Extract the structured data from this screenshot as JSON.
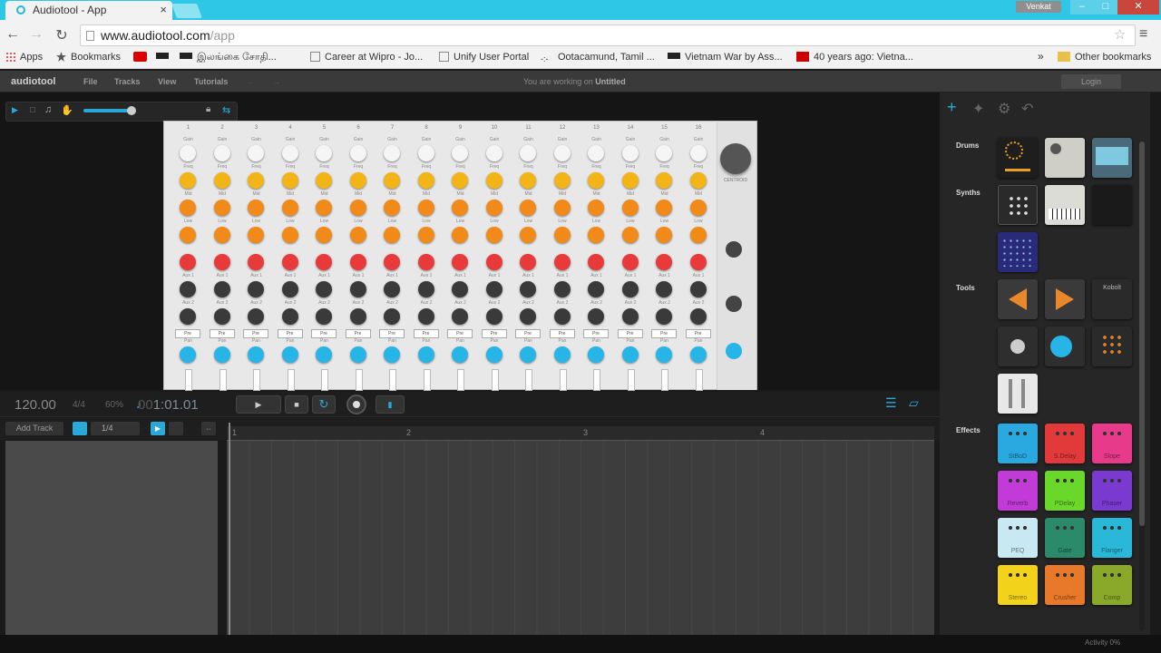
{
  "browser": {
    "tab_title": "Audiotool - App",
    "user_button": "Venkat",
    "url_host": "www.audiotool.com",
    "url_path": "/app",
    "bookmarks": [
      {
        "label": "Apps"
      },
      {
        "label": "Bookmarks"
      },
      {
        "label": ""
      },
      {
        "label": ""
      },
      {
        "label": "இலங்கை சோதி..."
      },
      {
        "label": "Career at Wipro - Jo..."
      },
      {
        "label": "Unify User Portal"
      },
      {
        "label": "Ootacamund, Tamil ..."
      },
      {
        "label": "Vietnam War by Ass..."
      },
      {
        "label": "40 years ago: Vietna..."
      }
    ],
    "more_bookmarks": "»",
    "other_bookmarks": "Other bookmarks"
  },
  "app": {
    "logo": "audiotool",
    "menu": [
      "File",
      "Tracks",
      "View",
      "Tutorials"
    ],
    "working_prefix": "You are working on",
    "working_doc": "Untitled",
    "login": "Login"
  },
  "mixer": {
    "channels": [
      "1",
      "2",
      "3",
      "4",
      "5",
      "6",
      "7",
      "8",
      "9",
      "10",
      "11",
      "12",
      "13",
      "14",
      "15",
      "16"
    ],
    "knob_labels": [
      "Gain",
      "Freq",
      "Mid",
      "Low",
      "Aux 1",
      "Aux 2",
      "Pan"
    ],
    "pre_label": "Pre",
    "master_label": "CENTROID",
    "colors": {
      "yellow": "#f2b416",
      "orange": "#f28a1a",
      "red": "#e83a3a",
      "dark": "#3a3a3a",
      "cyan": "#27b4e6",
      "white": "#f5f5f5"
    }
  },
  "transport": {
    "bpm": "120.00",
    "signature": "4/4",
    "shuffle": "60%",
    "time_dim": "00",
    "time": "1:01.01",
    "play": "▶",
    "stop": "■"
  },
  "tracks": {
    "add_track": "Add Track",
    "quantize": "1/4",
    "ruler_marks": [
      "1",
      "2",
      "3",
      "4"
    ]
  },
  "panel": {
    "sections": [
      "Drums",
      "Synths",
      "Tools",
      "Effects"
    ],
    "effects": [
      "StBoD",
      "S.Delay",
      "Slope",
      "Reverb",
      "PDelay",
      "Phaser",
      "PEQ",
      "Gate",
      "Flanger",
      "Stereo",
      "Crusher",
      "Comp"
    ],
    "tool_tile": "Kobolt"
  },
  "status": {
    "activity": "Activity 0%"
  }
}
